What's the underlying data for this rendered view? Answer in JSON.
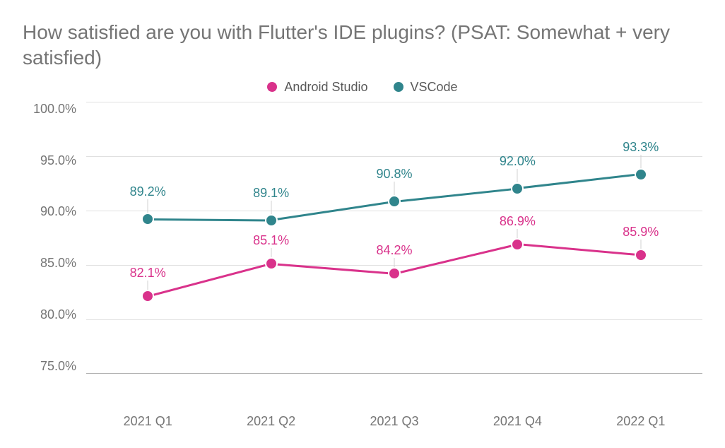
{
  "chart_data": {
    "type": "line",
    "title": "How satisfied are you with Flutter's IDE plugins? (PSAT: Somewhat + very satisfied)",
    "xlabel": "",
    "ylabel": "",
    "ylim": [
      75.0,
      100.0
    ],
    "y_ticks": [
      100.0,
      95.0,
      90.0,
      85.0,
      80.0,
      75.0
    ],
    "y_tick_labels": [
      "100.0%",
      "95.0%",
      "90.0%",
      "85.0%",
      "80.0%",
      "75.0%"
    ],
    "categories": [
      "2021 Q1",
      "2021 Q2",
      "2021 Q3",
      "2021 Q4",
      "2022 Q1"
    ],
    "series": [
      {
        "name": "Android Studio",
        "color": "#d9328b",
        "values": [
          82.1,
          85.1,
          84.2,
          86.9,
          85.9
        ],
        "value_labels": [
          "82.1%",
          "85.1%",
          "84.2%",
          "86.9%",
          "85.9%"
        ]
      },
      {
        "name": "VSCode",
        "color": "#30858c",
        "values": [
          89.2,
          89.1,
          90.8,
          92.0,
          93.3
        ],
        "value_labels": [
          "89.2%",
          "89.1%",
          "90.8%",
          "92.0%",
          "93.3%"
        ]
      }
    ]
  }
}
